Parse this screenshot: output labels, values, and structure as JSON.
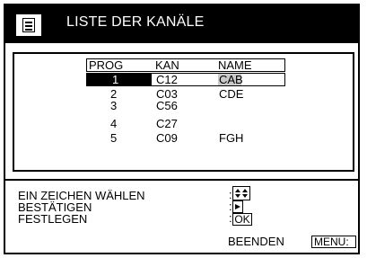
{
  "title": "LISTE DER KANÄLE",
  "table": {
    "headers": [
      "PROG",
      "KAN",
      "NAME"
    ],
    "rows": [
      {
        "prog": "1",
        "kan": "C12",
        "name": "CAB"
      },
      {
        "prog": "2",
        "kan": "C03",
        "name": "CDE"
      },
      {
        "prog": "3",
        "kan": "C56",
        "name": ""
      },
      {
        "prog": "4",
        "kan": "C27",
        "name": ""
      },
      {
        "prog": "5",
        "kan": "C09",
        "name": "FGH"
      }
    ],
    "selected_row": 0
  },
  "help": {
    "line1": "EIN ZEICHEN WÄHLEN",
    "line2": "BESTÄTIGEN",
    "line3": "FESTLEGEN",
    "ok_label": "OK"
  },
  "footer": {
    "exit_label": "BEENDEN",
    "menu_label": "MENU"
  },
  "icons": [
    "list-icon",
    "up-down-arrows-icon",
    "right-arrow-icon"
  ]
}
